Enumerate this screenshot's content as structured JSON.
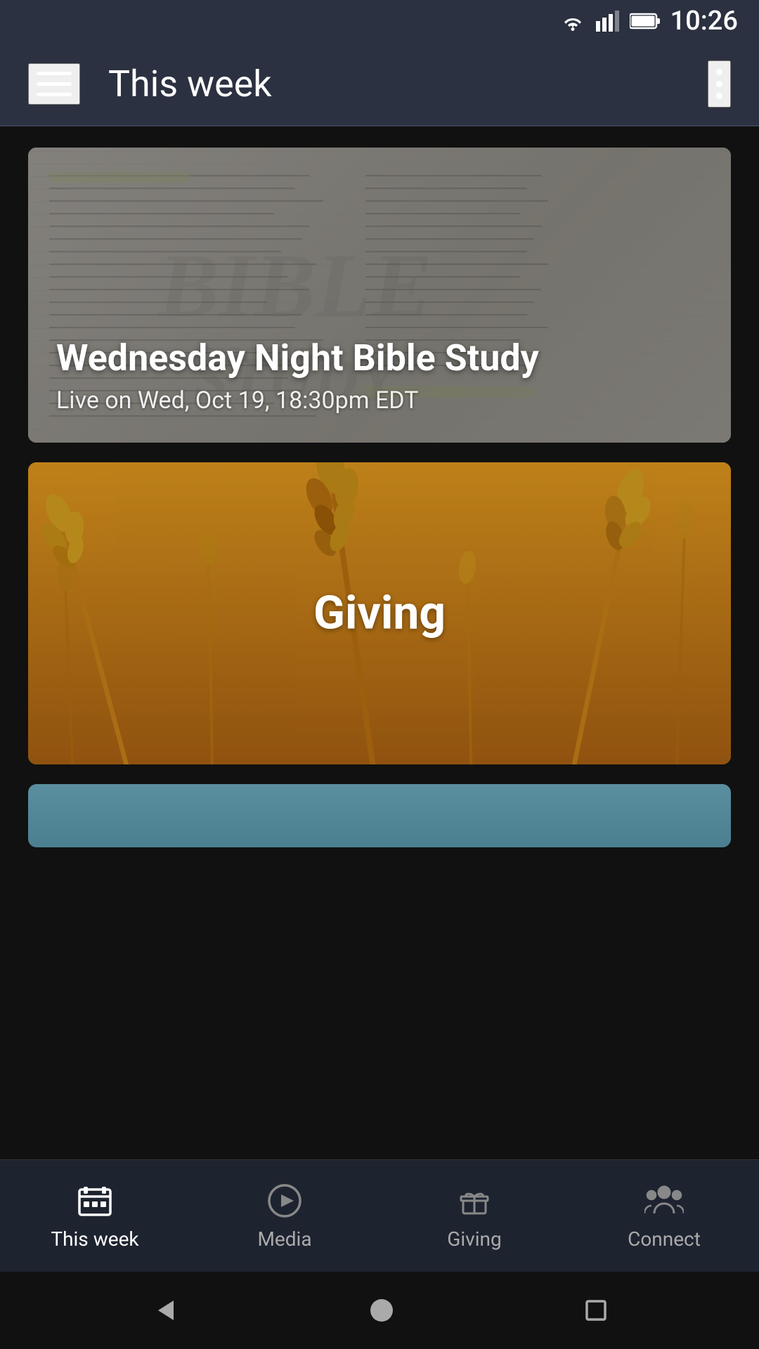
{
  "status_bar": {
    "time": "10:26"
  },
  "app_bar": {
    "title": "This week",
    "menu_icon": "hamburger-icon",
    "more_icon": "more-vertical-icon"
  },
  "cards": [
    {
      "id": "bible-study",
      "title": "Wednesday Night Bible Study",
      "subtitle": "Live on Wed, Oct 19, 18:30pm EDT",
      "bg_text": "BIBLE\nSTUDY"
    },
    {
      "id": "giving",
      "title": "Giving"
    },
    {
      "id": "third-card",
      "title": ""
    }
  ],
  "bottom_nav": {
    "items": [
      {
        "id": "this-week",
        "label": "This week",
        "icon": "calendar-icon",
        "active": true
      },
      {
        "id": "media",
        "label": "Media",
        "icon": "play-icon",
        "active": false
      },
      {
        "id": "giving",
        "label": "Giving",
        "icon": "gift-icon",
        "active": false
      },
      {
        "id": "connect",
        "label": "Connect",
        "icon": "people-icon",
        "active": false
      }
    ]
  },
  "system_nav": {
    "back": "◄",
    "home": "●",
    "recent": "■"
  }
}
